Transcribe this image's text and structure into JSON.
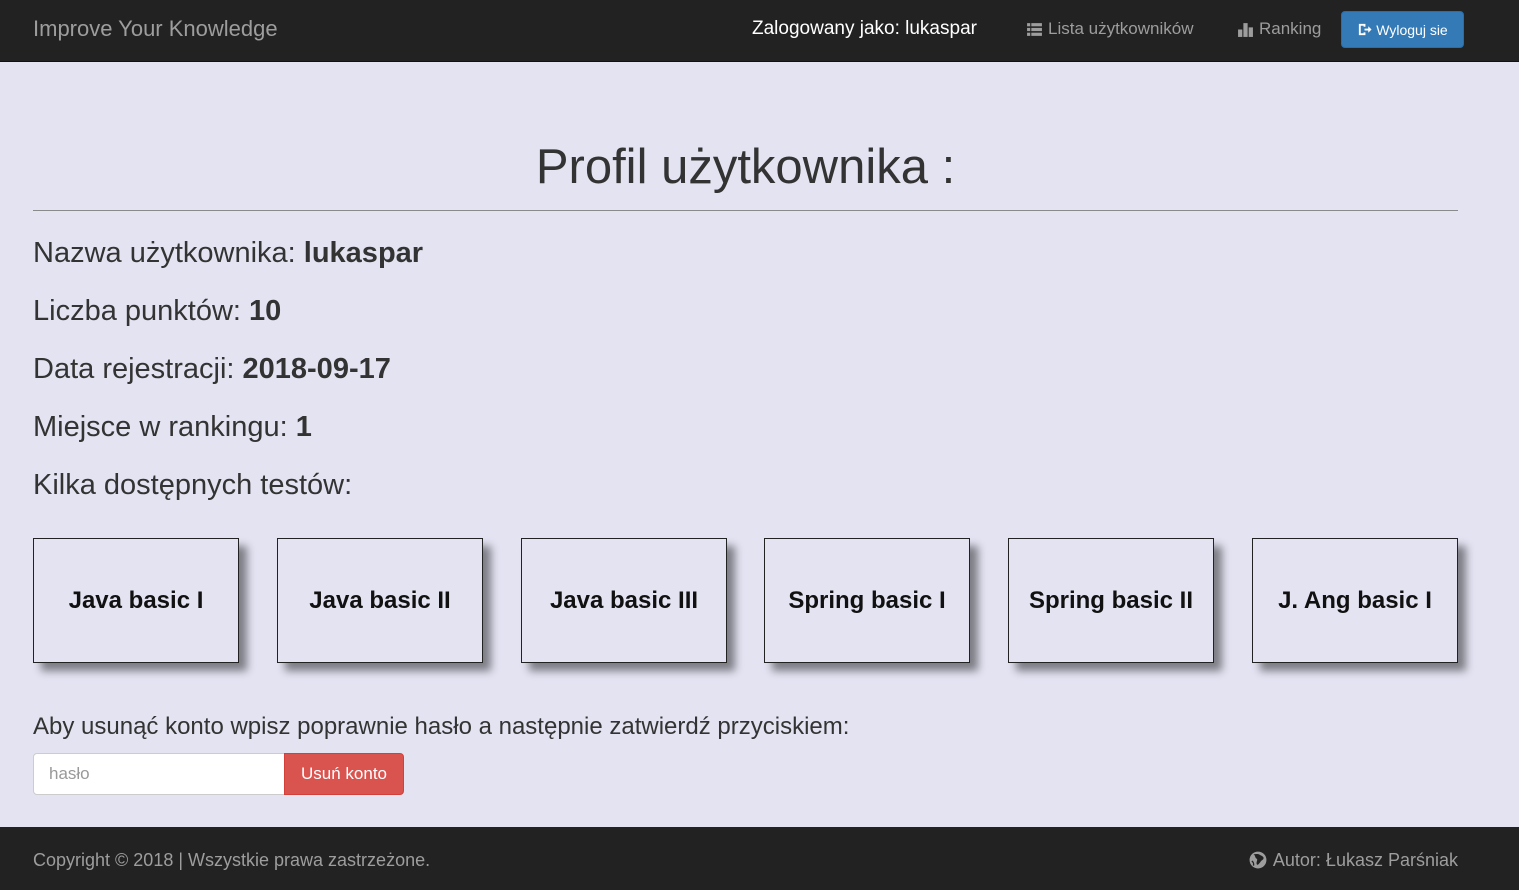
{
  "navbar": {
    "brand": "Improve Your Knowledge",
    "logged_in": "Zalogowany jako: lukaspar",
    "users_link": "Lista użytkowników",
    "users_icon": "list-icon",
    "ranking_link": "Ranking",
    "ranking_icon": "bar-chart-icon",
    "logout_button": "Wyloguj sie",
    "logout_icon": "logout-icon"
  },
  "main": {
    "title": "Profil użytkownika :",
    "username_label": "Nazwa użytkownika: ",
    "username": "lukaspar",
    "points_label": "Liczba punktów: ",
    "points": "10",
    "registration_label": "Data rejestracji: ",
    "registration_date": "2018-09-17",
    "rank_label": "Miejsce w rankingu: ",
    "rank": "1",
    "tests_heading": "Kilka dostępnych testów:",
    "tests": [
      "Java basic I",
      "Java basic II",
      "Java basic III",
      "Spring basic I",
      "Spring basic II",
      "J. Ang basic I"
    ],
    "delete_note": "Aby usunąć konto wpisz poprawnie hasło a następnie zatwierdź przyciskiem:",
    "password_placeholder": "hasło",
    "delete_button": "Usuń konto"
  },
  "footer": {
    "copyright": "Copyright © 2018 | Wszystkie prawa zastrzeżone.",
    "author": "Autor: Łukasz Parśniak",
    "author_icon": "globe-icon"
  },
  "colors": {
    "navbar_bg": "#222222",
    "page_bg": "#e3e3f2",
    "primary": "#337ab7",
    "danger": "#d9534f"
  }
}
